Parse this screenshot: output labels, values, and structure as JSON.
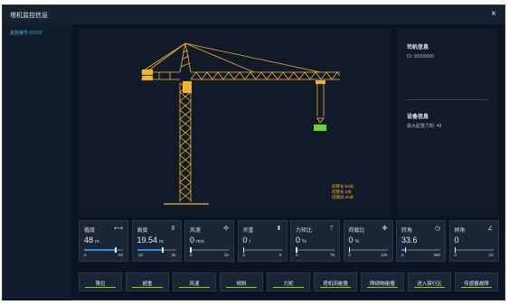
{
  "window": {
    "title": "塔机监控信息",
    "close_icon": "×"
  },
  "sidebar": {
    "items": [
      {
        "label": "黑匣编号:61970"
      }
    ]
  },
  "crane_readout": {
    "lines": [
      "前臂长:50米",
      "后臂长:2米",
      "塔帽高:30米"
    ]
  },
  "info_panel": {
    "section1_title": "司机信息",
    "section1_text": "ID: 00000000",
    "section2_title": "设备信息",
    "section2_text": "最大起重力矩: 48"
  },
  "gauges": [
    {
      "label": "幅度",
      "icon": "radius-icon",
      "value": "48",
      "unit": "m",
      "min": "0",
      "max": "60",
      "fill": 0.8
    },
    {
      "label": "高度",
      "icon": "height-icon",
      "value": "19.54",
      "unit": "m",
      "min": "-10",
      "max": "35",
      "fill": 0.65
    },
    {
      "label": "风速",
      "icon": "fan-icon",
      "value": "0",
      "unit": "m/s",
      "min": "0",
      "max": "32",
      "fill": 0
    },
    {
      "label": "吊重",
      "icon": "weight-icon",
      "value": "0",
      "unit": "t",
      "min": "0",
      "max": "6",
      "fill": 0
    },
    {
      "label": "力矩比",
      "icon": "moment-icon",
      "value": "0",
      "unit": "%",
      "min": "0",
      "max": "75",
      "fill": 0
    },
    {
      "label": "荷载比",
      "icon": "load-icon",
      "value": "0",
      "unit": "%",
      "min": "0",
      "max": "100",
      "fill": 0
    },
    {
      "label": "转角",
      "icon": "rotation-icon",
      "value": "33.6",
      "unit": "",
      "min": "0",
      "max": "360",
      "fill": 0.093
    },
    {
      "label": "倾角",
      "icon": "tilt-icon",
      "value": "0",
      "unit": "",
      "min": "0",
      "max": "10",
      "fill": 0
    }
  ],
  "alarms": [
    {
      "label": "限位",
      "color": "#8bc34a"
    },
    {
      "label": "超重",
      "color": "#8bc34a"
    },
    {
      "label": "风速",
      "color": "#8bc34a"
    },
    {
      "label": "倾斜",
      "color": "#8bc34a"
    },
    {
      "label": "力矩",
      "color": "#8bc34a"
    },
    {
      "label": "塔机间碰撞",
      "color": "#8bc34a"
    },
    {
      "label": "障碍物碰撞",
      "color": "#8bc34a"
    },
    {
      "label": "进入禁行区",
      "color": "#8bc34a"
    },
    {
      "label": "传感器故障",
      "color": "#8bc34a"
    }
  ],
  "colors": {
    "crane": "#f0b429",
    "hook_load": "#6bd43a",
    "accent": "#2f8fe0"
  }
}
